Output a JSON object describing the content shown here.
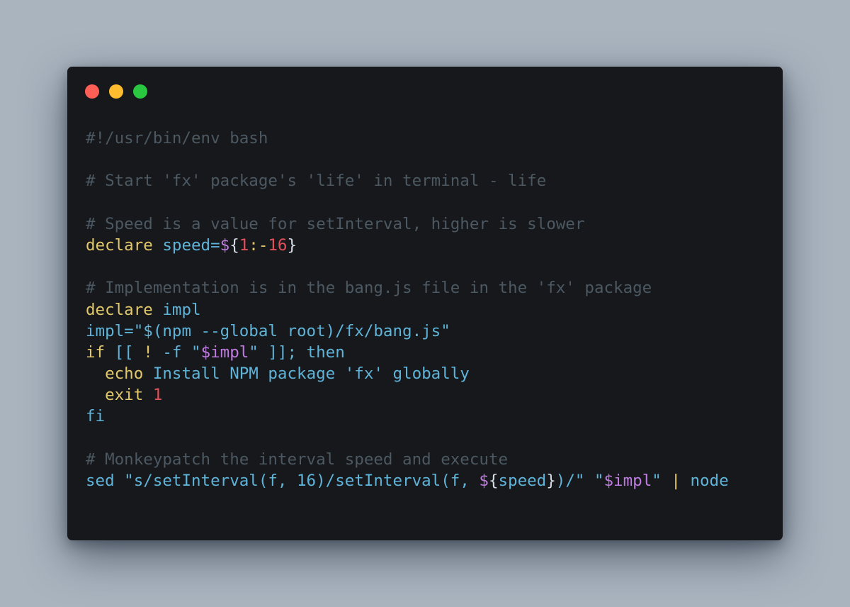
{
  "window": {
    "controls": [
      {
        "name": "close",
        "color": "#fd5f57"
      },
      {
        "name": "minimize",
        "color": "#febc2e"
      },
      {
        "name": "maximize",
        "color": "#29c840"
      }
    ]
  },
  "code": {
    "language": "bash",
    "colors": {
      "background": "#16181b",
      "comment": "#4c5862",
      "keyword": "#e2c86a",
      "identifier": "#5fb3d9",
      "variable": "#c07be0",
      "number": "#e0505a",
      "plain": "#d6dde4"
    },
    "lines": [
      [
        {
          "t": "#!/usr/bin/env bash",
          "c": "comment"
        }
      ],
      [],
      [
        {
          "t": "# Start 'fx' package's 'life' in terminal - life",
          "c": "comment"
        }
      ],
      [],
      [
        {
          "t": "# Speed is a value for setInterval, higher is slower",
          "c": "comment"
        }
      ],
      [
        {
          "t": "declare",
          "c": "keyword"
        },
        {
          "t": " speed=",
          "c": "ident"
        },
        {
          "t": "$",
          "c": "var"
        },
        {
          "t": "{",
          "c": "plain"
        },
        {
          "t": "1",
          "c": "num"
        },
        {
          "t": ":-",
          "c": "keyword"
        },
        {
          "t": "16",
          "c": "num"
        },
        {
          "t": "}",
          "c": "plain"
        }
      ],
      [],
      [
        {
          "t": "# Implementation is in the bang.js file in the 'fx' package",
          "c": "comment"
        }
      ],
      [
        {
          "t": "declare",
          "c": "keyword"
        },
        {
          "t": " impl",
          "c": "ident"
        }
      ],
      [
        {
          "t": "impl=\"$(npm --global root)/fx/bang.js\"",
          "c": "ident"
        }
      ],
      [
        {
          "t": "if",
          "c": "keyword"
        },
        {
          "t": " [[ ",
          "c": "ident"
        },
        {
          "t": "!",
          "c": "keyword"
        },
        {
          "t": " -f ",
          "c": "ident"
        },
        {
          "t": "\"",
          "c": "ident"
        },
        {
          "t": "$impl",
          "c": "var"
        },
        {
          "t": "\"",
          "c": "ident"
        },
        {
          "t": " ]]; then",
          "c": "ident"
        }
      ],
      [
        {
          "t": "  echo",
          "c": "keyword"
        },
        {
          "t": " Install NPM package 'fx' globally",
          "c": "ident"
        }
      ],
      [
        {
          "t": "  exit",
          "c": "keyword"
        },
        {
          "t": " ",
          "c": "plain"
        },
        {
          "t": "1",
          "c": "num"
        }
      ],
      [
        {
          "t": "fi",
          "c": "ident"
        }
      ],
      [],
      [
        {
          "t": "# Monkeypatch the interval speed and execute",
          "c": "comment"
        }
      ],
      [
        {
          "t": "sed \"s/setInterval(f, 16)/setInterval(f, ",
          "c": "ident"
        },
        {
          "t": "$",
          "c": "var"
        },
        {
          "t": "{",
          "c": "plain"
        },
        {
          "t": "speed",
          "c": "ident"
        },
        {
          "t": "}",
          "c": "plain"
        },
        {
          "t": ")/\" \"",
          "c": "ident"
        },
        {
          "t": "$impl",
          "c": "var"
        },
        {
          "t": "\"",
          "c": "ident"
        },
        {
          "t": " | ",
          "c": "keyword"
        },
        {
          "t": "node",
          "c": "ident"
        }
      ]
    ]
  }
}
